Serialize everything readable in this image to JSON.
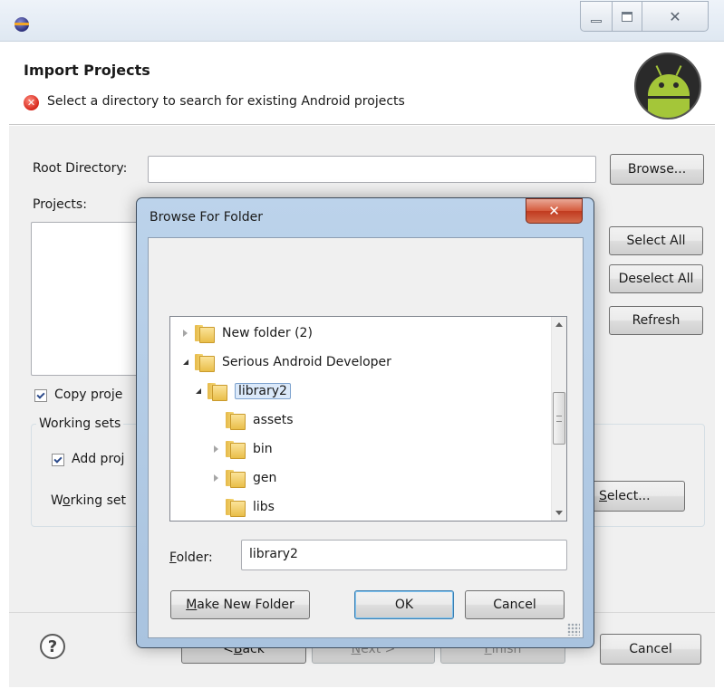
{
  "window": {
    "controls": {
      "minimize": "",
      "maximize": "",
      "close": "✕"
    }
  },
  "header": {
    "title": "Import Projects",
    "message": "Select a directory to search for existing Android projects",
    "error_glyph": "✕"
  },
  "form": {
    "root_directory_label": "Root Directory:",
    "root_directory_value": "",
    "browse_label": "Browse...",
    "projects_label": "Projects:",
    "select_all_label": "Select All",
    "deselect_all_label": "Deselect All",
    "refresh_label": "Refresh",
    "copy_label": "Copy proje",
    "working_sets_title": "Working sets",
    "add_label": "Add proj",
    "working_set_label_pre": "W",
    "working_set_label_mn": "o",
    "working_set_label_post": "rking set",
    "select_label_mn": "S",
    "select_label_post": "elect..."
  },
  "footer": {
    "help_glyph": "?",
    "back_label_pre": "< ",
    "back_label_mn": "B",
    "back_label_post": "ack",
    "next_label_pre": "",
    "next_label_mn": "N",
    "next_label_post": "ext >",
    "finish_label_pre": "",
    "finish_label_mn": "F",
    "finish_label_post": "inish",
    "cancel_label": "Cancel"
  },
  "dialog": {
    "title": "Browse For Folder",
    "close_glyph": "✕",
    "tree": [
      {
        "label": "New folder (2)"
      },
      {
        "label": "Serious Android Developer"
      },
      {
        "label": "library2"
      },
      {
        "label": "assets"
      },
      {
        "label": "bin"
      },
      {
        "label": "gen"
      },
      {
        "label": "libs"
      }
    ],
    "folder_label_mn": "F",
    "folder_label_post": "older:",
    "folder_value": "library2",
    "make_new_folder_mn": "M",
    "make_new_folder_post": "ake New Folder",
    "ok_label": "OK",
    "cancel_label": "Cancel"
  }
}
